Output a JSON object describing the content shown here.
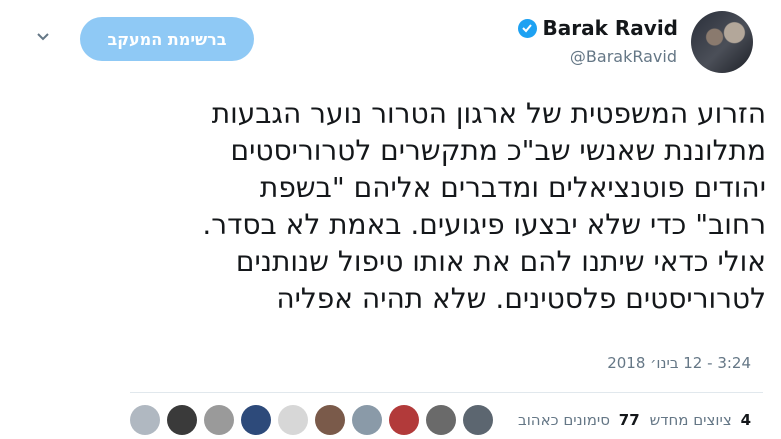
{
  "header": {
    "display_name": "Barak Ravid",
    "handle": "@BarakRavid",
    "follow_button_label": "ברשימת המעקב"
  },
  "tweet": {
    "lines": [
      "הזרוע המשפטית של ארגון הטרור נוער הגבעות",
      "מתלוננת שאנשי שב\"כ מתקשרים לטרוריסטים",
      "יהודים פוטנציאלים ומדברים  אליהם \"בשפת",
      "רחוב\" כדי שלא יבצעו פיגועים. באמת לא בסדר.",
      "אולי כדאי שיתנו להם את אותו טיפול שנותנים",
      "לטרוריסטים פלסטינים. שלא תהיה אפליה"
    ],
    "timestamp": "3:24 - 12 בינו׳ 2018"
  },
  "stats": {
    "retweets_count": "4",
    "retweets_label": "ציוצים מחדש",
    "likes_count": "77",
    "likes_label": "סימונים כאהוב"
  },
  "colors": {
    "accent": "#1da1f2",
    "follow_button": "#8fc9f5",
    "secondary_text": "#657786"
  },
  "icons": {
    "verified": "verified-badge-icon",
    "menu": "chevron-down-icon"
  },
  "liker_avatars": [
    {
      "color": "#b0b8c1"
    },
    {
      "color": "#3a3a3a"
    },
    {
      "color": "#9a9a9a"
    },
    {
      "color": "#2d4a7a"
    },
    {
      "color": "#d7d7d7"
    },
    {
      "color": "#7a5a4a"
    },
    {
      "color": "#8a9aa8"
    },
    {
      "color": "#b23a3a"
    },
    {
      "color": "#6a6a6a"
    },
    {
      "color": "#5c6670"
    }
  ]
}
